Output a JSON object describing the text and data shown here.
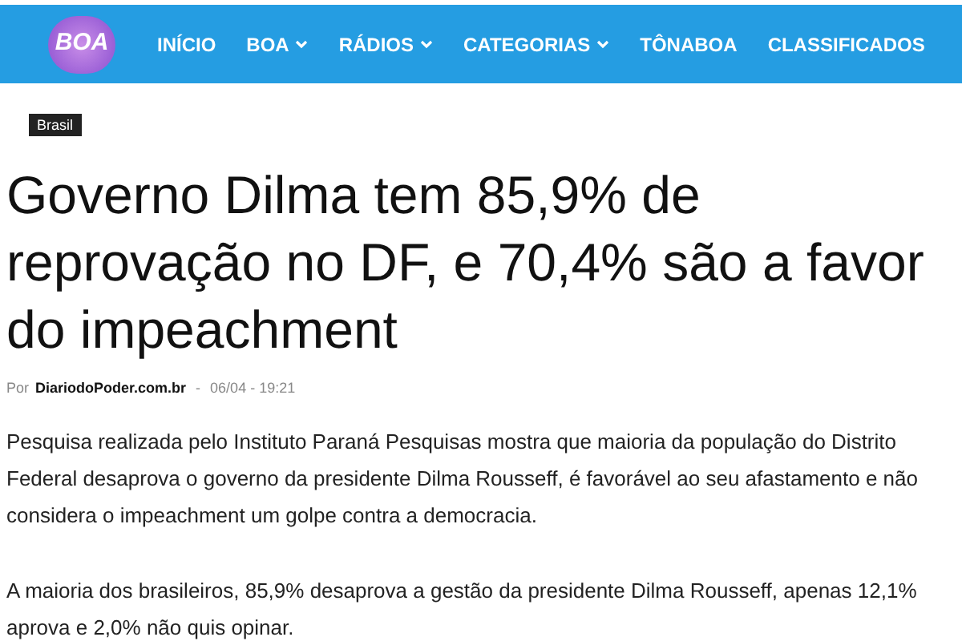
{
  "header": {
    "logo": "BOA",
    "menu": [
      {
        "label": "INÍCIO",
        "dropdown": false
      },
      {
        "label": "BOA",
        "dropdown": true
      },
      {
        "label": "RÁDIOS",
        "dropdown": true
      },
      {
        "label": "CATEGORIAS",
        "dropdown": true
      },
      {
        "label": "TÔNABOA",
        "dropdown": false
      },
      {
        "label": "CLASSIFICADOS",
        "dropdown": false
      }
    ]
  },
  "article": {
    "category": "Brasil",
    "title": "Governo Dilma tem 85,9% de reprovação no DF, e 70,4% são a favor do impeachment",
    "byline": {
      "prefix": "Por",
      "author": "DiariodoPoder.com.br",
      "separator": "-",
      "date": "06/04 - 19:21"
    },
    "paragraphs": [
      "Pesquisa realizada pelo Instituto Paraná Pesquisas mostra que maioria da população do Distrito Federal desaprova o governo da presidente Dilma Rousseff, é favorável ao seu afastamento e não considera o impeachment um golpe contra a democracia.",
      "A maioria dos brasileiros, 85,9% desaprova a gestão da presidente Dilma Rousseff, apenas 12,1% aprova e 2,0% não quis opinar."
    ]
  }
}
